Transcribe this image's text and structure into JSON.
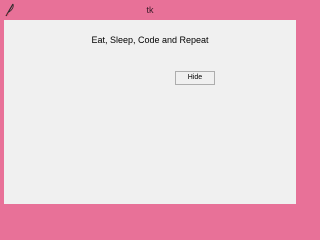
{
  "window": {
    "title": "tk",
    "frame_color": "#e87198",
    "client_color": "#f0f0f0"
  },
  "icons": {
    "app": "tk-feather-icon"
  },
  "main": {
    "message": "Eat, Sleep, Code and Repeat",
    "hide_button_label": "Hide"
  }
}
